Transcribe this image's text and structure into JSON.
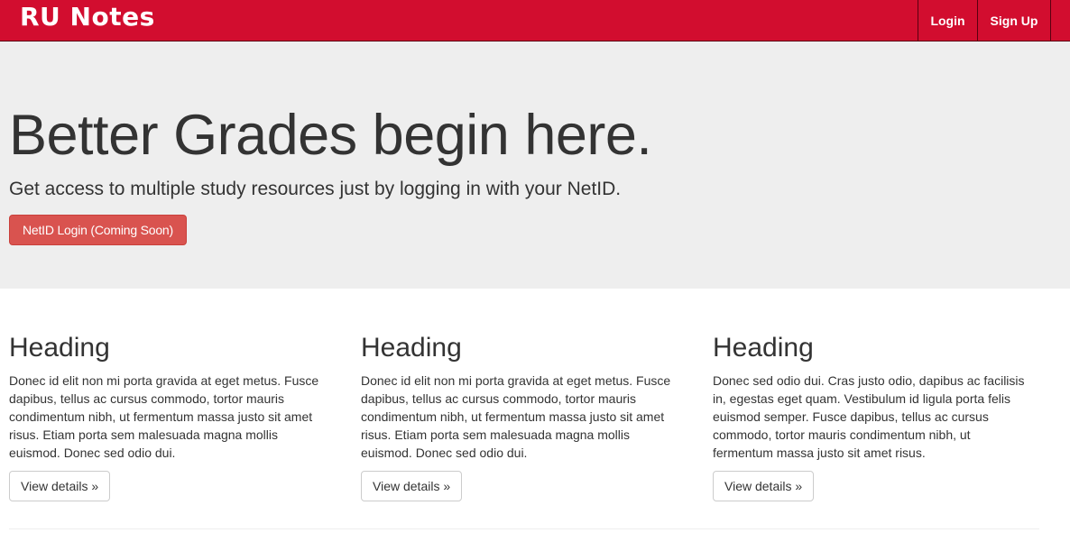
{
  "navbar": {
    "brand": "RU Notes",
    "links": [
      {
        "label": "Login"
      },
      {
        "label": "Sign Up"
      }
    ],
    "color": "#d20d2f"
  },
  "jumbotron": {
    "title": "Better Grades begin here.",
    "subtitle": "Get access to multiple study resources just by logging in with your NetID.",
    "button_label": "NetID Login (Coming Soon)",
    "button_color": "#d9534f"
  },
  "columns": [
    {
      "heading": "Heading",
      "text": "Donec id elit non mi porta gravida at eget metus. Fusce dapibus, tellus ac cursus commodo, tortor mauris condimentum nibh, ut fermentum massa justo sit amet risus. Etiam porta sem malesuada magna mollis euismod. Donec sed odio dui.",
      "button_label": "View details »"
    },
    {
      "heading": "Heading",
      "text": "Donec id elit non mi porta gravida at eget metus. Fusce dapibus, tellus ac cursus commodo, tortor mauris condimentum nibh, ut fermentum massa justo sit amet risus. Etiam porta sem malesuada magna mollis euismod. Donec sed odio dui.",
      "button_label": "View details »"
    },
    {
      "heading": "Heading",
      "text": "Donec sed odio dui. Cras justo odio, dapibus ac facilisis in, egestas eget quam. Vestibulum id ligula porta felis euismod semper. Fusce dapibus, tellus ac cursus commodo, tortor mauris condimentum nibh, ut fermentum massa justo sit amet risus.",
      "button_label": "View details »"
    }
  ]
}
